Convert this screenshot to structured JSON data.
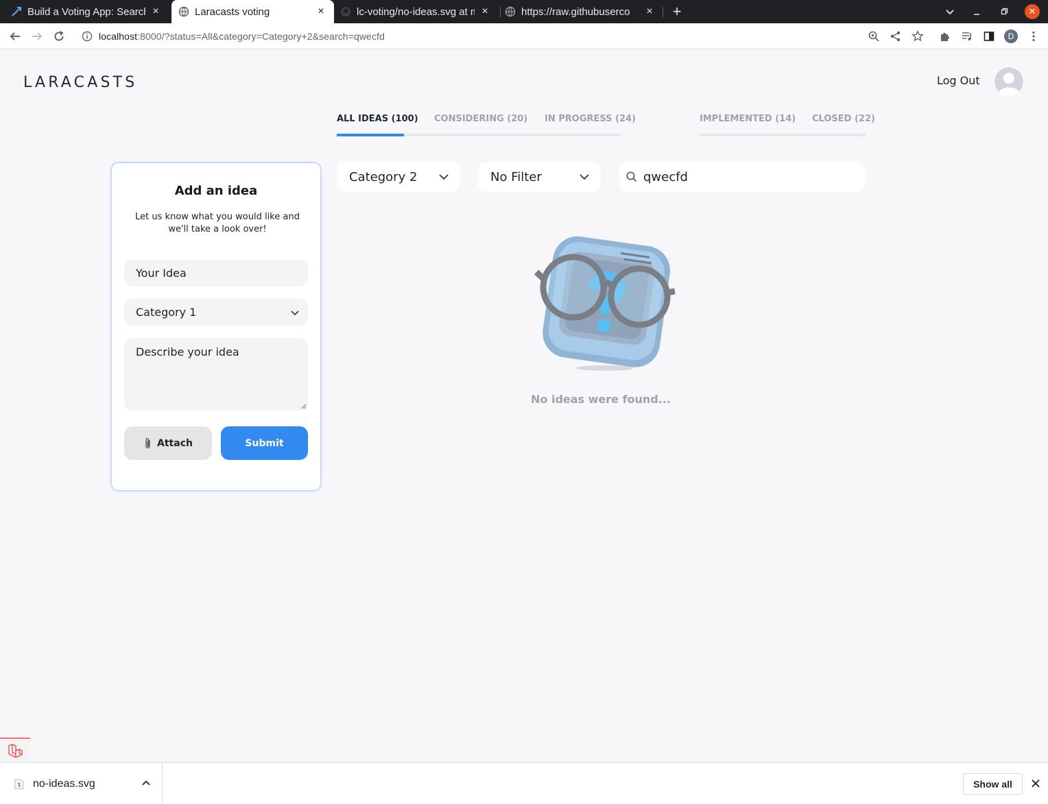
{
  "browser": {
    "tabs": [
      {
        "title": "Build a Voting App: Search",
        "close": "×"
      },
      {
        "title": "Laracasts voting",
        "close": "×"
      },
      {
        "title": "lc-voting/no-ideas.svg at m",
        "close": "×"
      },
      {
        "title": "https://raw.githubuserco",
        "close": "×"
      }
    ],
    "new_tab": "+",
    "url_host": "localhost",
    "url_rest": ":8000/?status=All&category=Category+2&search=qwecfd",
    "profile_initial": "D"
  },
  "header": {
    "logo_text": "LARACASTS",
    "logout_label": "Log Out"
  },
  "status_tabs": [
    {
      "label": "ALL IDEAS (100)",
      "active": true
    },
    {
      "label": "CONSIDERING (20)",
      "active": false
    },
    {
      "label": "IN PROGRESS (24)",
      "active": false
    },
    {
      "label": "IMPLEMENTED (14)",
      "active": false
    },
    {
      "label": "CLOSED (22)",
      "active": false
    }
  ],
  "add_idea": {
    "title": "Add an idea",
    "subtitle": "Let us know what you would like and we'll take a look over!",
    "idea_placeholder": "Your Idea",
    "category_value": "Category 1",
    "description_placeholder": "Describe your idea",
    "attach_label": "Attach",
    "submit_label": "Submit"
  },
  "filters": {
    "category_value": "Category 2",
    "other_filter_value": "No Filter",
    "search_value": "qwecfd"
  },
  "empty_state": {
    "message": "No ideas were found..."
  },
  "downloads": {
    "file_name": "no-ideas.svg",
    "show_all_label": "Show all"
  },
  "colors": {
    "accent": "#328af1",
    "card_border": "#bfdbfe",
    "page_bg": "#f7f7f9",
    "muted_text": "#9ca3af"
  }
}
